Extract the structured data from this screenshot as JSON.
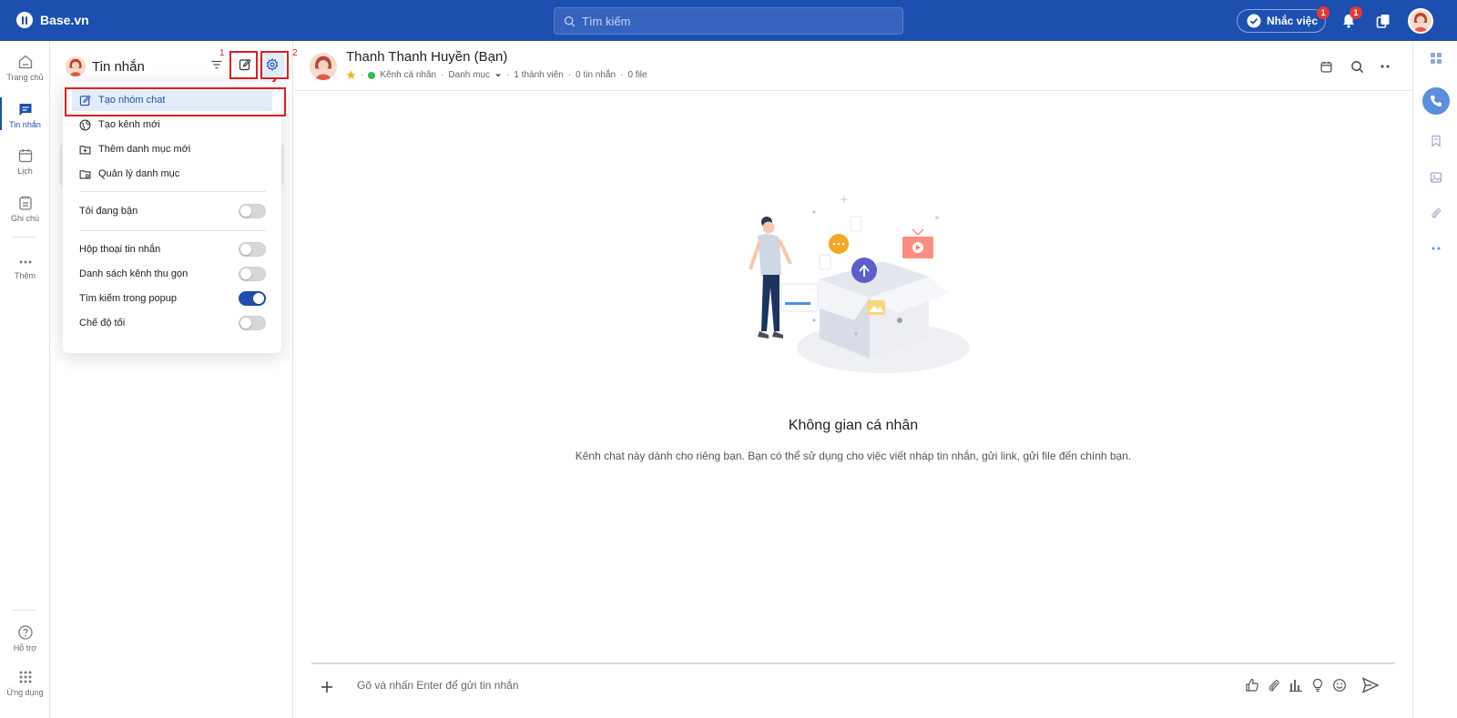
{
  "brand": {
    "name": "Base.vn"
  },
  "search": {
    "placeholder": "Tìm kiếm"
  },
  "topbar": {
    "reminder_label": "Nhắc việc",
    "reminder_badge": "1",
    "notification_badge": "1"
  },
  "leftnav": {
    "items": [
      {
        "label": "Trang chủ",
        "icon": "home-icon"
      },
      {
        "label": "Tin nhắn",
        "icon": "chat-icon",
        "active": true
      },
      {
        "label": "Lịch",
        "icon": "calendar-icon"
      },
      {
        "label": "Ghi chú",
        "icon": "note-icon"
      },
      {
        "label": "Thêm",
        "icon": "more-icon"
      }
    ],
    "support_label": "Hỗ trợ",
    "apps_label": "Ứng dụng"
  },
  "listpanel": {
    "title": "Tin nhắn",
    "annotation_1": "1",
    "annotation_2": "2"
  },
  "menu": {
    "items": [
      {
        "label": "Tạo nhóm chat",
        "icon": "edit-icon"
      },
      {
        "label": "Tạo kênh mới",
        "icon": "globe-icon"
      },
      {
        "label": "Thêm danh mục mới",
        "icon": "folder-add-icon"
      },
      {
        "label": "Quản lý danh mục",
        "icon": "folder-settings-icon"
      }
    ],
    "toggles": [
      {
        "label": "Tôi đang bận",
        "on": false
      },
      {
        "label": "Hộp thoại tin nhắn",
        "on": false
      },
      {
        "label": "Danh sách kênh thu gọn",
        "on": false
      },
      {
        "label": "Tìm kiếm trong popup",
        "on": true
      },
      {
        "label": "Chế độ tối",
        "on": false
      }
    ]
  },
  "chat": {
    "name": "Thanh Thanh Huyền (Bạn)",
    "meta": {
      "channel": "Kênh cá nhân",
      "category": "Danh mục",
      "members": "1 thành viên",
      "messages": "0 tin nhắn",
      "files": "0 file"
    },
    "empty_title": "Không gian cá nhân",
    "empty_desc": "Kênh chat này dành cho riêng bạn. Bạn có thể sử dụng cho việc viết nháp tin nhắn, gửi link, gửi file đến chính bạn.",
    "composer_placeholder": "Gõ và nhấn Enter để gửi tin nhắn"
  },
  "colors": {
    "brand": "#1c4fb0",
    "highlight": "#e01e1e",
    "online": "#2fbf4a",
    "star": "#f5b400"
  }
}
